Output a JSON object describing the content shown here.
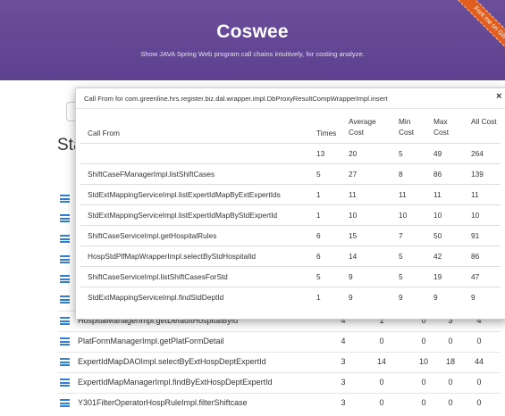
{
  "header": {
    "title": "Coswee",
    "subtitle": "Show JAVA Spring Web program call chains intuitively, for costing analyze.",
    "ribbon": "Fork me on GitHub"
  },
  "background": {
    "heading_fragment": "Sta",
    "rows": [
      {
        "name": "HospitalManagerImpl.getDefaultHospitalById",
        "times": "4",
        "avg": "1",
        "min": "0",
        "max": "3",
        "all": "4"
      },
      {
        "name": "PlatFormManagerImpl.getPlatFormDetail",
        "times": "4",
        "avg": "0",
        "min": "0",
        "max": "0",
        "all": "0"
      },
      {
        "name": "ExpertIdMapDAOImpl.selectByExtHospDeptExpertId",
        "times": "3",
        "avg": "14",
        "min": "10",
        "max": "18",
        "all": "44"
      },
      {
        "name": "ExpertIdMapManagerImpl.findByExtHospDeptExpertId",
        "times": "3",
        "avg": "0",
        "min": "0",
        "max": "0",
        "all": "0"
      },
      {
        "name": "Y301FilterOperatorHospRuleImpl.filterShiftcase",
        "times": "3",
        "avg": "0",
        "min": "0",
        "max": "0",
        "all": "0"
      }
    ]
  },
  "modal": {
    "title": "Call From for com.greenline.hrs.register.biz.dal.wrapper.impl.DbProxyResultCompWrapperImpl.insert",
    "close": "×",
    "headers": {
      "call_from": "Call From",
      "times": "Times",
      "avg": "Average Cost",
      "min": "Min Cost",
      "max": "Max Cost",
      "all": "All Cost"
    },
    "rows": [
      {
        "from": "",
        "times": "13",
        "avg": "20",
        "min": "5",
        "max": "49",
        "all": "264"
      },
      {
        "from": "ShiftCaseFManagerImpl.listShiftCases",
        "times": "5",
        "avg": "27",
        "min": "8",
        "max": "86",
        "all": "139"
      },
      {
        "from": "StdExtMappingServiceImpl.listExpertIdMapByExtExpertIds",
        "times": "1",
        "avg": "11",
        "min": "11",
        "max": "11",
        "all": "11"
      },
      {
        "from": "StdExtMappingServiceImpl.listExpertIdMapByStdExpertId",
        "times": "1",
        "avg": "10",
        "min": "10",
        "max": "10",
        "all": "10"
      },
      {
        "from": "ShiftCaseServiceImpl.getHospitalRules",
        "times": "6",
        "avg": "15",
        "min": "7",
        "max": "50",
        "all": "91"
      },
      {
        "from": "HospStdPlfMapWrapperImpl.selectByStdHospitalId",
        "times": "6",
        "avg": "14",
        "min": "5",
        "max": "42",
        "all": "86"
      },
      {
        "from": "ShiftCaseServiceImpl.listShiftCasesForStd",
        "times": "5",
        "avg": "9",
        "min": "5",
        "max": "19",
        "all": "47"
      },
      {
        "from": "StdExtMappingServiceImpl.findStdDeptId",
        "times": "1",
        "avg": "9",
        "min": "9",
        "max": "9",
        "all": "9"
      }
    ]
  }
}
